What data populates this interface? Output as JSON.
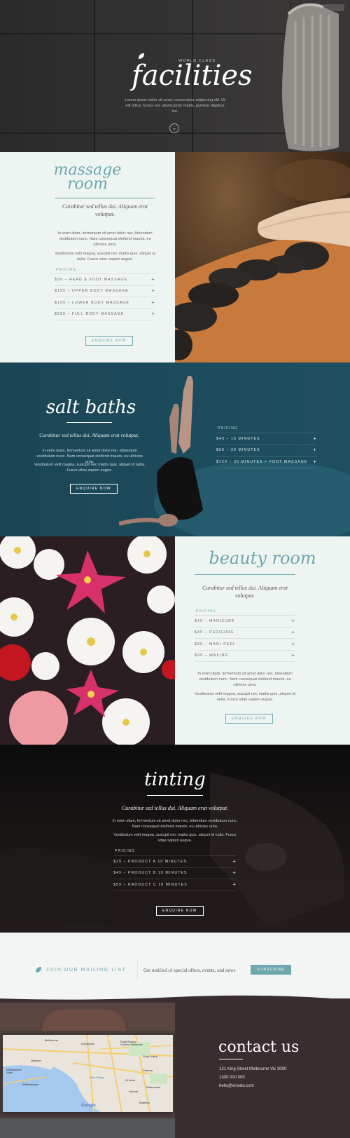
{
  "hero": {
    "kicker": "WORLD CLASS",
    "title": "facilities",
    "body": "Lorem ipsum dolor sit amet, consectetur adipiscing elit. Ut elit tellus, luctus nec ullamcorper mattis, pulvinar dapibus leo."
  },
  "massage": {
    "title_line1": "massage",
    "title_line2": "room",
    "subtitle": "Curabitur sed tellus dui. Aliquam erat volutpat.",
    "para1": "In enim diam, fermentum sit amet dolor nec, bibendum vestibulum nunc. Nam consequat eleifend mauris, eu ultricies urna.",
    "para2": "Vestibulum velit magna, suscipit nec mattis quis, aliquet id nulla. Fusce vitae sapien augue.",
    "pricing_label": "PRICING",
    "prices": [
      "$99 – HEAD & FOOT MASSAGE",
      "$199 – UPPER BODY MASSAGE",
      "$199 – LOWER BODY MASSAGE",
      "$299 – FULL BODY MASSAGE"
    ],
    "button": "ENQUIRE NOW"
  },
  "salt": {
    "title": "salt baths",
    "subtitle": "Curabitur sed tellus dui. Aliquam erat volutpat.",
    "para1": "In enim diam, fermentum sit amet dolor nec, bibendum vestibulum nunc. Nam consequat eleifend mauris, eu ultricies urna.",
    "para2": "Vestibulum velit magna, suscipit nec mattis quis, aliquet id nulla. Fusce vitae sapien augue.",
    "button": "ENQUIRE NOW",
    "pricing_label": "PRICING",
    "prices": [
      "$49 – 15 MINUTES",
      "$69 – 30 MINUTES",
      "$129 – 30 MINUTES + FOOT MASSAGE"
    ]
  },
  "beauty": {
    "title": "beauty room",
    "subtitle": "Curabitur sed tellus dui. Aliquam erat volutpat.",
    "pricing_label": "PRICING",
    "prices": [
      "$49 – MANICURE",
      "$49 – PEDICURE",
      "$89 – MANI-PEDI",
      "$99 – WAXING"
    ],
    "para1": "In enim diam, fermentum sit amet dolor nec, bibendum vestibulum nunc. Nam consequat eleifend mauris, eu ultricies urna.",
    "para2": "Vestibulum velit magna, suscipit nec mattis quis, aliquet id nulla. Fusce vitae sapien augue.",
    "button": "ENQUIRE NOW"
  },
  "tinting": {
    "title": "tinting",
    "subtitle": "Curabitur sed tellus dui. Aliquam erat volutpat.",
    "para1": "In enim diam, fermentum sit amet dolor nec, bibendum vestibulum nunc. Nam consequat eleifend mauris, eu ultricies urna.",
    "para2": "Vestibulum velit magna, suscipit nec mattis quis, aliquet id nulla. Fusce vitae sapien augue.",
    "pricing_label": "PRICING",
    "prices": [
      "$29 – PRODUCT A 10 MINUTES",
      "$49 – PRODUCT B 10 MINUTES",
      "$59 – PRODUCT C 10 MINUTES"
    ],
    "button": "ENQUIRE NOW"
  },
  "mailing": {
    "title": "JOIN OUR MAILING LIST",
    "text": "Get notified of special offers, events, and news",
    "button": "SUBSCRIBE"
  },
  "map": {
    "places": [
      "Melbourne",
      "Docklands",
      "Royal Botanic Gardens Melbourne",
      "Newport",
      "South Yarra",
      "Williamstown North",
      "Williamstown",
      "Prahran",
      "Port Phillip",
      "St Kilda",
      "Elwood",
      "Elsternwick",
      "Brighton",
      "Google"
    ]
  },
  "contact": {
    "title": "contact us",
    "address": "121 King Street Melbourne Vic 3000",
    "phone": "1300 000 000",
    "email": "hello@envato.com"
  },
  "colors": {
    "accent": "#6fa7ae",
    "dark_teal": "#1c4b5c",
    "contact_bg": "#3a2d30"
  }
}
